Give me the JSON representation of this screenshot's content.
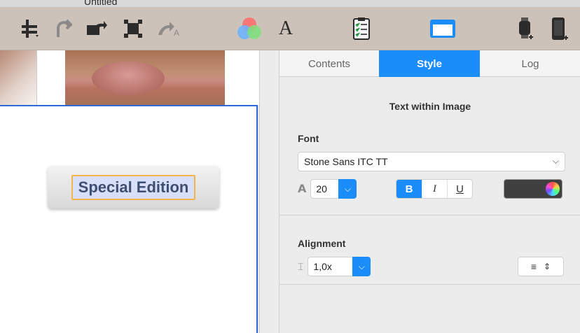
{
  "window": {
    "title": "Untitled"
  },
  "toolbar": {
    "icons": [
      "guides-icon",
      "undo-icon",
      "redo-icon",
      "crop-icon",
      "text-path-icon",
      "color-picker-icon",
      "font-icon",
      "checklist-icon",
      "inspector-panel-icon",
      "watch-add-icon",
      "phone-add-icon"
    ],
    "font_glyph": "A"
  },
  "canvas": {
    "badge_text": "Special Edition"
  },
  "inspector": {
    "tabs": [
      {
        "label": "Contents"
      },
      {
        "label": "Style"
      },
      {
        "label": "Log"
      }
    ],
    "section_title": "Text within Image",
    "font": {
      "label": "Font",
      "family": "Stone Sans ITC TT",
      "size": "20",
      "bold": "B",
      "italic": "I",
      "underline": "U",
      "color": "#404040"
    },
    "alignment": {
      "label": "Alignment",
      "line_spacing": "1,0x"
    }
  }
}
